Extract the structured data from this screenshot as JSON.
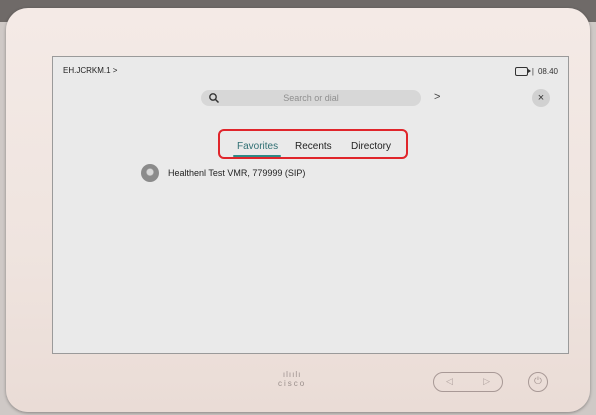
{
  "header": {
    "breadcrumb": "EH.JCRKM.1 >",
    "time_separator": "|",
    "time": "08.40"
  },
  "search": {
    "placeholder": "Search or dial",
    "go_icon": ">"
  },
  "close": {
    "label": "×"
  },
  "tabs": [
    {
      "label": "Favorites",
      "active": true
    },
    {
      "label": "Recents",
      "active": false
    },
    {
      "label": "Directory",
      "active": false
    }
  ],
  "favorites": [
    {
      "name": "Healthenl Test VMR, 779999 (SIP)"
    }
  ],
  "device": {
    "brand": "cisco",
    "volume_minus": "◁",
    "volume_plus": "▷",
    "power_icon": "⏻"
  },
  "colors": {
    "highlight_box": "#e0252b",
    "active_tab": "#2f8a87"
  }
}
